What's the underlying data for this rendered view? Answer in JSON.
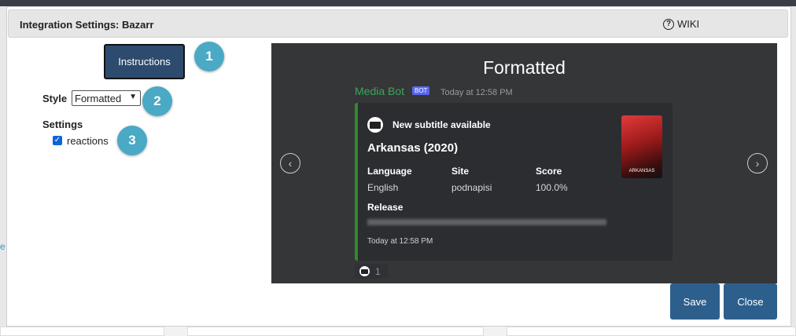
{
  "modal": {
    "title": "Integration Settings: Bazarr",
    "wiki_label": "WIKI",
    "instructions_label": "Instructions",
    "style_label": "Style",
    "style_value": "Formatted",
    "settings_label": "Settings",
    "reactions_label": "reactions",
    "reactions_checked": true,
    "save_label": "Save",
    "close_label": "Close"
  },
  "markers": [
    "1",
    "2",
    "3"
  ],
  "background": {
    "link_fragment": "e"
  },
  "preview": {
    "title": "Formatted",
    "bot_name": "Media Bot",
    "bot_badge": "BOT",
    "bot_time": "Today at 12:58 PM",
    "embed": {
      "author": "New subtitle available",
      "title": "Arkansas (2020)",
      "fields": [
        {
          "name": "Language",
          "value": "English"
        },
        {
          "name": "Site",
          "value": "podnapisi"
        },
        {
          "name": "Score",
          "value": "100.0%"
        }
      ],
      "release_label": "Release",
      "footer": "Today at 12:58 PM",
      "poster_text": "ARKANSAS",
      "accent_color": "#2e8b2e"
    },
    "reaction_count": "1"
  },
  "colors": {
    "button": "#2d5f8d",
    "instructions_button": "#2d4b6e",
    "marker": "#4aa9c4",
    "preview_bg": "#353638",
    "embed_bg": "#2b2d31"
  },
  "icons": [
    "question-circle-icon",
    "chevron-left-icon",
    "chevron-right-icon",
    "media-bot-icon",
    "chevron-down-icon",
    "checkmark-icon"
  ]
}
